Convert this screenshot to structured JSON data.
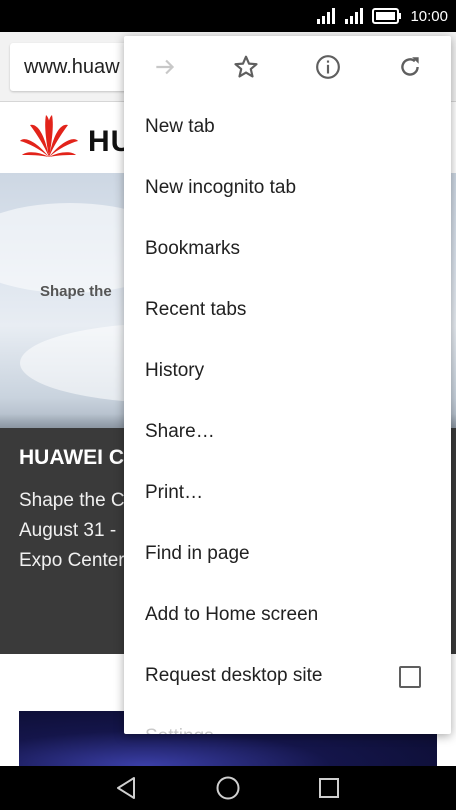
{
  "status_bar": {
    "time": "10:00",
    "icons": [
      "signal-icon",
      "signal-icon",
      "battery-icon"
    ]
  },
  "browser": {
    "url": "www.huaw"
  },
  "page": {
    "logo_text": "HU",
    "hero_text": "Shape the",
    "panel_title": "HUAWEI C",
    "panel_lines": [
      "Shape the C",
      "August 31 -",
      "Expo Center,"
    ]
  },
  "menu": {
    "icon_row": [
      "forward-arrow-icon",
      "star-icon",
      "info-icon",
      "refresh-icon"
    ],
    "items": [
      {
        "label": "New tab"
      },
      {
        "label": "New incognito tab"
      },
      {
        "label": "Bookmarks"
      },
      {
        "label": "Recent tabs"
      },
      {
        "label": "History"
      },
      {
        "label": "Share…"
      },
      {
        "label": "Print…"
      },
      {
        "label": "Find in page"
      },
      {
        "label": "Add to Home screen"
      },
      {
        "label": "Request desktop site",
        "checked": false
      },
      {
        "label": "Settings"
      }
    ]
  },
  "nav_bar": {
    "buttons": [
      "back-icon",
      "home-icon",
      "recents-icon"
    ]
  },
  "colors": {
    "menu_text": "#212121",
    "icon_gray": "#5f5f5f",
    "disabled_icon": "#c8c8c8",
    "dark_panel": "#3a3a3a",
    "huawei_red": "#e2231a"
  }
}
